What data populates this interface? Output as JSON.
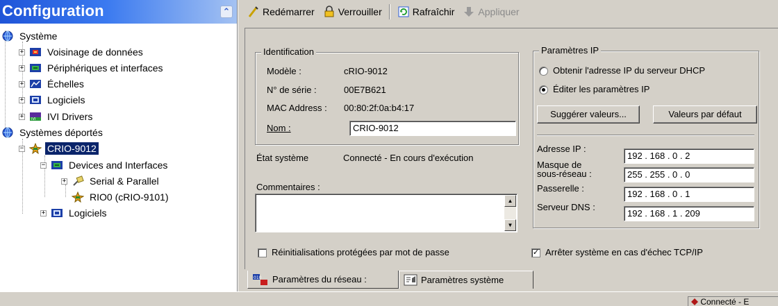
{
  "tree": {
    "header_title": "Configuration",
    "items": [
      {
        "label": "Système"
      },
      {
        "label": "Voisinage de données"
      },
      {
        "label": "Périphériques et interfaces"
      },
      {
        "label": "Échelles"
      },
      {
        "label": "Logiciels"
      },
      {
        "label": "IVI Drivers"
      },
      {
        "label": "Systèmes déportés"
      },
      {
        "label": "CRIO-9012"
      },
      {
        "label": "Devices and Interfaces"
      },
      {
        "label": "Serial & Parallel"
      },
      {
        "label": "RIO0 (cRIO-9101)"
      },
      {
        "label": "Logiciels"
      }
    ]
  },
  "toolbar": {
    "restart": "Redémarrer",
    "lock": "Verrouiller",
    "refresh": "Rafraîchir",
    "apply": "Appliquer"
  },
  "identification": {
    "legend": "Identification",
    "model_label": "Modèle :",
    "model_value": "cRIO-9012",
    "serial_label": "N° de série :",
    "serial_value": "00E7B621",
    "mac_label": "MAC Address :",
    "mac_value": "00:80:2f:0a:b4:17",
    "name_label": "Nom :",
    "name_value": "CRIO-9012"
  },
  "system_state": {
    "label": "État système",
    "value": "Connecté - En cours d'exécution"
  },
  "comments": {
    "label": "Commentaires :",
    "value": ""
  },
  "ip_params": {
    "legend": "Paramètres IP",
    "dhcp_option": "Obtenir l'adresse IP du serveur DHCP",
    "edit_option": "Éditer les paramètres IP",
    "selected_option": "edit",
    "suggest_button": "Suggérer valeurs...",
    "defaults_button": "Valeurs par défaut",
    "ip_label": "Adresse IP :",
    "ip_value": "192 . 168 .  0  .  2",
    "mask_label_1": "Masque de",
    "mask_label_2": "sous-réseau :",
    "mask_value": "255 . 255 .  0  .  0",
    "gateway_label": "Passerelle :",
    "gateway_value": "192 . 168 .  0  .  1",
    "dns_label": "Serveur DNS :",
    "dns_value": "192 . 168 .  1  . 209"
  },
  "options": {
    "password_reset_label": "Réinitialisations protégées par mot de passe",
    "password_reset_checked": false,
    "halt_on_tcp_fail_label": "Arrêter système en cas d'échec TCP/IP",
    "halt_on_tcp_fail_checked": true
  },
  "tabs": [
    {
      "label": "Paramètres du réseau :",
      "active": true
    },
    {
      "label": "Paramètres système",
      "active": false
    }
  ],
  "status": {
    "text": "Connecté - E"
  },
  "colors": {
    "header_blue": "#1f54d8",
    "selection": "#0a246a",
    "face": "#d4d0c8"
  }
}
